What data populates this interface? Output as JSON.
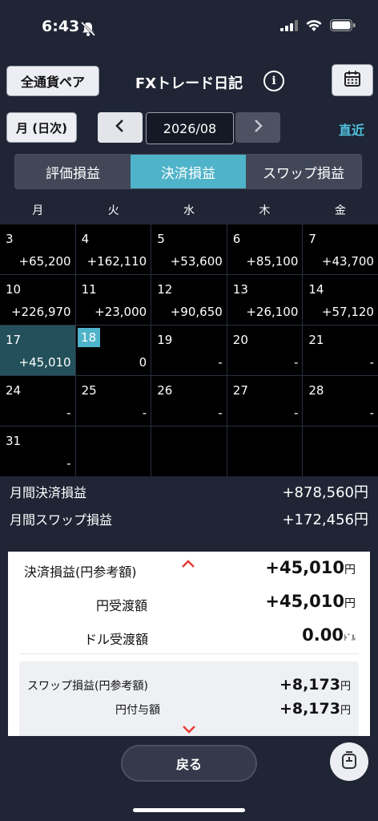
{
  "status_bar": {
    "time": "6:43"
  },
  "header": {
    "currency_button": "全通貨ペア",
    "title": "FXトレード日記",
    "info_icon": "info-icon",
    "calendar_icon": "calendar-icon"
  },
  "nav": {
    "period_button": "月 (日次)",
    "prev_symbol": "<",
    "date": "2026/08",
    "next_symbol": ">",
    "recent_link": "直近"
  },
  "tabs": [
    {
      "label": "評価損益",
      "active": false
    },
    {
      "label": "決済損益",
      "active": true
    },
    {
      "label": "スワップ損益",
      "active": false
    }
  ],
  "weekdays": [
    "月",
    "火",
    "水",
    "木",
    "金"
  ],
  "calendar": [
    {
      "day": "3",
      "amount": "+65,200"
    },
    {
      "day": "4",
      "amount": "+162,110"
    },
    {
      "day": "5",
      "amount": "+53,600"
    },
    {
      "day": "6",
      "amount": "+85,100"
    },
    {
      "day": "7",
      "amount": "+43,700"
    },
    {
      "day": "10",
      "amount": "+226,970"
    },
    {
      "day": "11",
      "amount": "+23,000"
    },
    {
      "day": "12",
      "amount": "+90,650"
    },
    {
      "day": "13",
      "amount": "+26,100"
    },
    {
      "day": "14",
      "amount": "+57,120"
    },
    {
      "day": "17",
      "amount": "+45,010"
    },
    {
      "day": "18",
      "amount": "0"
    },
    {
      "day": "19",
      "amount": "-"
    },
    {
      "day": "20",
      "amount": "-"
    },
    {
      "day": "21",
      "amount": "-"
    },
    {
      "day": "24",
      "amount": "-"
    },
    {
      "day": "25",
      "amount": "-"
    },
    {
      "day": "26",
      "amount": "-"
    },
    {
      "day": "27",
      "amount": "-"
    },
    {
      "day": "28",
      "amount": "-"
    },
    {
      "day": "31",
      "amount": "-"
    },
    {
      "day": "",
      "amount": ""
    },
    {
      "day": "",
      "amount": ""
    },
    {
      "day": "",
      "amount": ""
    },
    {
      "day": "",
      "amount": ""
    }
  ],
  "selected_day": "17",
  "today_day": "18",
  "totals": {
    "settlement_label": "月間決済損益",
    "settlement_value": "+878,560円",
    "swap_label": "月間スワップ損益",
    "swap_value": "+172,456円"
  },
  "detail": {
    "settlement_label": "決済損益(円参考額)",
    "settlement_value": "+45,010",
    "settlement_unit": "円",
    "yen_label": "円受渡額",
    "yen_value": "+45,010",
    "yen_unit": "円",
    "dollar_label": "ドル受渡額",
    "dollar_value": "0.00",
    "dollar_unit": "ﾄﾞﾙ",
    "swap": {
      "label": "スワップ損益(円参考額)",
      "value": "+8,173",
      "unit": "円",
      "yen_label": "円付与額",
      "yen_value": "+8,173",
      "yen_unit": "円"
    }
  },
  "bottom": {
    "back_button": "戻る"
  },
  "colors": {
    "accent": "#4fb3c9",
    "background": "#1f2535",
    "chevron": "#e53935"
  }
}
